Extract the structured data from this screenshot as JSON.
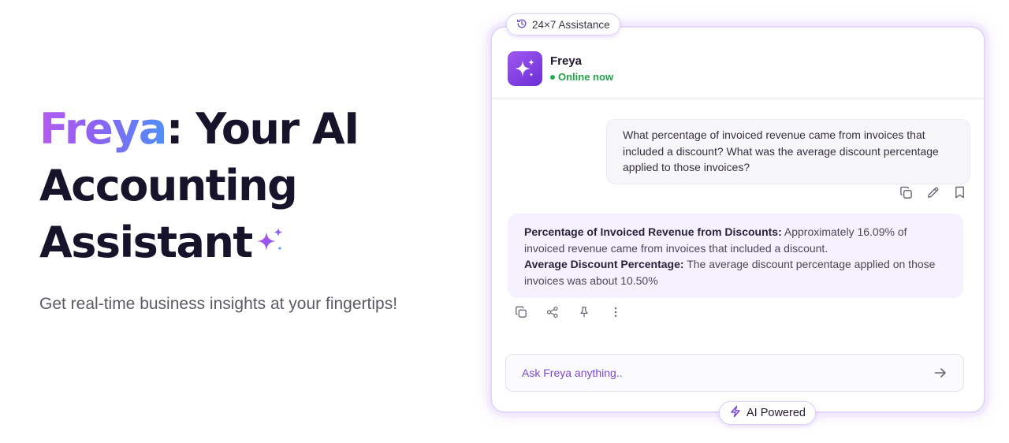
{
  "hero": {
    "title_brand": "Freya",
    "title_rest": ": Your AI",
    "title_line2": "Accounting",
    "title_line3": "Assistant",
    "subtitle": "Get real-time business insights at your fingertips!"
  },
  "badges": {
    "top": "24×7 Assistance",
    "bottom": "AI Powered"
  },
  "chat": {
    "agent_name": "Freya",
    "status": "Online now",
    "user_message": "What percentage of invoiced revenue came from invoices that included a discount? What was the average discount percentage applied to those invoices?",
    "ai_response": {
      "label1": "Percentage of Invoiced Revenue from Discounts:",
      "text1": " Approximately 16.09% of invoiced revenue came from invoices that included a discount.",
      "label2": "Average Discount Percentage:",
      "text2": " The average discount percentage applied on those invoices was about 10.50%"
    },
    "input_placeholder": "Ask Freya anything.."
  },
  "icons": {
    "user_actions": [
      "copy-icon",
      "edit-icon",
      "bookmark-icon"
    ],
    "ai_actions": [
      "copy-icon",
      "share-icon",
      "pin-icon",
      "more-icon"
    ],
    "send": "arrow-right-icon",
    "history": "history-icon",
    "bolt": "bolt-icon"
  },
  "colors": {
    "accent": "#7a48d6",
    "online": "#22a34a",
    "ai_bubble": "#f5f1fe"
  }
}
